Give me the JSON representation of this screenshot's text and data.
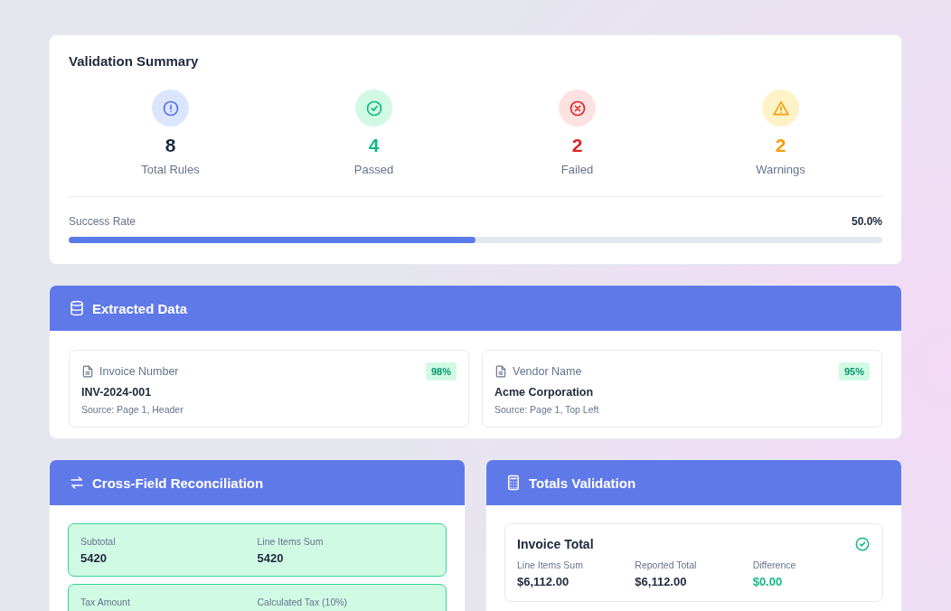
{
  "summary": {
    "title": "Validation Summary",
    "stats": [
      {
        "kind": "total",
        "value": "8",
        "label": "Total Rules"
      },
      {
        "kind": "passed",
        "value": "4",
        "label": "Passed"
      },
      {
        "kind": "failed",
        "value": "2",
        "label": "Failed"
      },
      {
        "kind": "warning",
        "value": "2",
        "label": "Warnings"
      }
    ],
    "success_rate": {
      "label": "Success Rate",
      "reading": "50.0%",
      "level": 0.5
    }
  },
  "extracted": {
    "title": "Extracted Data",
    "fields": [
      {
        "label": "Invoice Number",
        "confidence": "98%",
        "value": "INV-2024-001",
        "source": "Source: Page 1, Header"
      },
      {
        "label": "Vendor Name",
        "confidence": "95%",
        "value": "Acme Corporation",
        "source": "Source: Page 1, Top Left"
      }
    ]
  },
  "reconciliation": {
    "title": "Cross-Field Reconciliation",
    "rows": [
      {
        "matched": true,
        "left_label": "Subtotal",
        "left_value": "5420",
        "right_label": "Line Items Sum",
        "right_value": "5420"
      },
      {
        "matched": true,
        "left_label": "Tax Amount",
        "right_label": "Calculated Tax (10%)"
      }
    ]
  },
  "totals": {
    "title": "Totals Validation",
    "checks": [
      {
        "title": "Invoice Total",
        "passed": true,
        "items": [
          {
            "kind": "plain",
            "label": "Line Items Sum",
            "value": "$6,112.00"
          },
          {
            "kind": "plain",
            "label": "Reported Total",
            "value": "$6,112.00"
          },
          {
            "kind": "difference",
            "label": "Difference",
            "value": "$0.00"
          }
        ]
      }
    ]
  }
}
